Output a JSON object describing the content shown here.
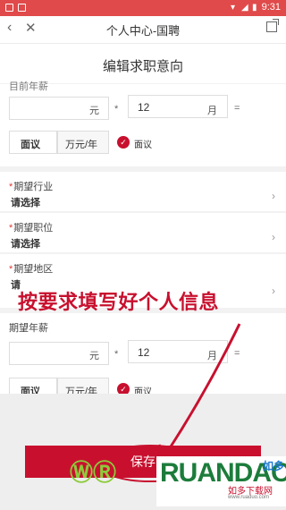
{
  "status": {
    "time": "9:31"
  },
  "nav": {
    "title": "个人中心-国聘"
  },
  "page": {
    "title": "编辑求职意向"
  },
  "current_salary": {
    "label": "目前年薪",
    "input_value": "",
    "unit_wan": "元",
    "times": "*",
    "months": "12",
    "months_unit": "月",
    "equals": "=",
    "negotiable_box": "面议",
    "unit_box": "万元/年",
    "checkbox_label": "面议"
  },
  "industry": {
    "label": "期望行业",
    "value": "请选择"
  },
  "position": {
    "label": "期望职位",
    "value": "请选择"
  },
  "region": {
    "label": "期望地区",
    "value": "请"
  },
  "expected_salary": {
    "label": "期望年薪",
    "input_value": "",
    "unit_wan": "元",
    "times": "*",
    "months": "12",
    "months_unit": "月",
    "equals": "=",
    "negotiable_box": "面议",
    "unit_box": "万元/年",
    "checkbox_label": "面议"
  },
  "annotation": {
    "text": "按要求填写好个人信息"
  },
  "save_button": {
    "label": "保存"
  },
  "watermark": {
    "brand": "RUANDAO",
    "logo": "如多",
    "cn": "如多下载网",
    "url": "www.ruaduo.com"
  }
}
